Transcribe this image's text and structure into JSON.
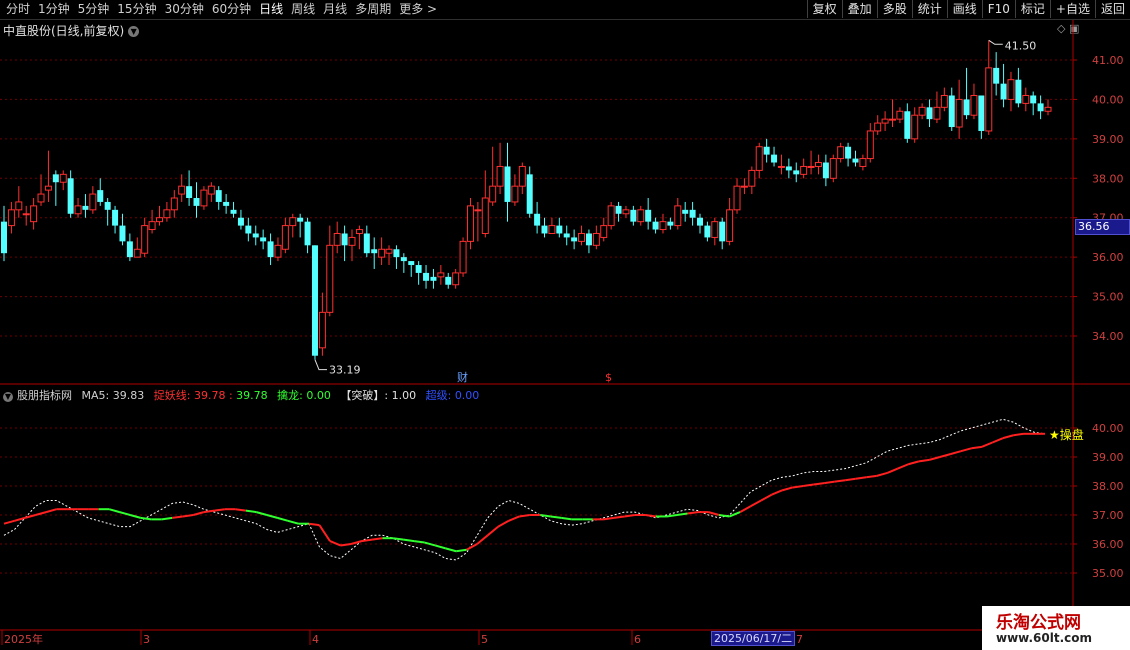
{
  "toolbar": {
    "periods": [
      "分时",
      "1分钟",
      "5分钟",
      "15分钟",
      "30分钟",
      "60分钟",
      "日线",
      "周线",
      "月线",
      "多周期",
      "更多 >"
    ],
    "actions": [
      "复权",
      "叠加",
      "多股",
      "统计",
      "画线",
      "F10",
      "标记",
      "+自选",
      "返回"
    ]
  },
  "stock": {
    "title": "中直股份(日线,前复权)"
  },
  "price_axis": {
    "labels": [
      "41.00",
      "40.00",
      "39.00",
      "38.00",
      "37.00",
      "36.00",
      "35.00",
      "34.00"
    ],
    "current": "36.56"
  },
  "indicator_axis": {
    "labels": [
      "40.00",
      "39.00",
      "38.00",
      "37.00",
      "36.00",
      "35.00"
    ]
  },
  "annotations": {
    "high": "41.50",
    "low": "33.19",
    "cai": "财",
    "s_marker": "$"
  },
  "indicator": {
    "name": "股朋指标网",
    "ma5_label": "MA5:",
    "ma5_value": "39.83",
    "line1_label": "捉妖线:",
    "line1_v1": "39.78",
    "sep": " : ",
    "line1_v2": "39.78",
    "line2_label": "擒龙:",
    "line2_value": "0.00",
    "line3_label": "【突破】:",
    "line3_value": "1.00",
    "line4_label": "超级:",
    "line4_value": "0.00",
    "signal": "★操盘"
  },
  "date_axis": {
    "labels": [
      "2025年",
      "3",
      "4",
      "5",
      "6",
      "7"
    ],
    "selected": "2025/06/17/二"
  },
  "watermark": {
    "line1": "乐淘公式网",
    "line2": "www.60lt.com"
  },
  "colors": {
    "up": "#ff3030",
    "down": "#54ffff",
    "grid": "#6e0000",
    "ma_red": "#ff2020",
    "ma_green": "#30ff30",
    "dotted": "#ffffff"
  },
  "chart_data": {
    "type": "candlestick",
    "candles": [
      [
        36.9,
        36.1,
        37.3,
        35.9
      ],
      [
        36.8,
        37.2,
        37.4,
        36.6
      ],
      [
        37.2,
        37.4,
        37.8,
        37.0
      ],
      [
        37.1,
        37.1,
        37.3,
        36.8
      ],
      [
        36.9,
        37.3,
        37.5,
        36.7
      ],
      [
        37.4,
        37.6,
        38.1,
        37.3
      ],
      [
        37.7,
        37.8,
        38.7,
        37.4
      ],
      [
        38.1,
        37.9,
        38.2,
        37.3
      ],
      [
        37.9,
        38.1,
        38.2,
        37.7
      ],
      [
        38.0,
        37.1,
        38.2,
        37.0
      ],
      [
        37.1,
        37.3,
        37.5,
        37.0
      ],
      [
        37.3,
        37.2,
        37.6,
        37.0
      ],
      [
        37.2,
        37.6,
        37.8,
        37.1
      ],
      [
        37.7,
        37.4,
        38.0,
        37.3
      ],
      [
        37.4,
        37.2,
        37.5,
        36.8
      ],
      [
        37.2,
        36.8,
        37.3,
        36.6
      ],
      [
        36.8,
        36.4,
        37.1,
        36.3
      ],
      [
        36.4,
        36.0,
        36.6,
        35.9
      ],
      [
        36.0,
        36.2,
        36.5,
        36.0
      ],
      [
        36.1,
        36.8,
        37.0,
        36.0
      ],
      [
        36.7,
        36.9,
        37.2,
        36.6
      ],
      [
        36.9,
        37.0,
        37.3,
        36.8
      ],
      [
        37.0,
        37.2,
        37.4,
        36.9
      ],
      [
        37.2,
        37.5,
        37.7,
        37.0
      ],
      [
        37.6,
        37.8,
        38.1,
        37.4
      ],
      [
        37.8,
        37.5,
        38.2,
        37.3
      ],
      [
        37.5,
        37.3,
        37.9,
        37.0
      ],
      [
        37.3,
        37.7,
        37.8,
        37.2
      ],
      [
        37.6,
        37.8,
        37.9,
        37.4
      ],
      [
        37.7,
        37.4,
        37.8,
        37.2
      ],
      [
        37.4,
        37.3,
        37.6,
        37.1
      ],
      [
        37.2,
        37.1,
        37.4,
        37.0
      ],
      [
        37.0,
        36.8,
        37.2,
        36.7
      ],
      [
        36.8,
        36.6,
        37.0,
        36.4
      ],
      [
        36.6,
        36.5,
        36.8,
        36.3
      ],
      [
        36.5,
        36.4,
        36.7,
        36.2
      ],
      [
        36.4,
        36.0,
        36.6,
        35.8
      ],
      [
        36.0,
        36.3,
        36.5,
        35.9
      ],
      [
        36.2,
        36.8,
        37.0,
        36.1
      ],
      [
        36.8,
        37.0,
        37.1,
        36.5
      ],
      [
        37.0,
        36.9,
        37.1,
        36.5
      ],
      [
        36.9,
        36.3,
        37.0,
        36.1
      ],
      [
        36.3,
        33.5,
        36.3,
        33.4
      ],
      [
        33.7,
        34.6,
        35.1,
        33.5
      ],
      [
        34.6,
        36.3,
        36.8,
        34.5
      ],
      [
        36.3,
        36.6,
        36.9,
        36.1
      ],
      [
        36.6,
        36.3,
        36.8,
        35.9
      ],
      [
        36.3,
        36.5,
        36.7,
        35.9
      ],
      [
        36.6,
        36.7,
        36.8,
        36.2
      ],
      [
        36.6,
        36.1,
        36.8,
        36.0
      ],
      [
        36.2,
        36.1,
        36.5,
        35.7
      ],
      [
        36.0,
        36.2,
        36.5,
        35.8
      ],
      [
        36.1,
        36.2,
        36.3,
        35.8
      ],
      [
        36.2,
        36.0,
        36.3,
        35.7
      ],
      [
        36.0,
        35.9,
        36.1,
        35.6
      ],
      [
        35.9,
        35.8,
        35.9,
        35.5
      ],
      [
        35.8,
        35.6,
        35.9,
        35.3
      ],
      [
        35.6,
        35.4,
        35.8,
        35.2
      ],
      [
        35.5,
        35.4,
        35.7,
        35.2
      ],
      [
        35.5,
        35.6,
        35.8,
        35.3
      ],
      [
        35.5,
        35.3,
        35.6,
        35.2
      ],
      [
        35.3,
        35.6,
        35.7,
        35.2
      ],
      [
        35.6,
        36.4,
        36.5,
        35.5
      ],
      [
        36.4,
        37.3,
        37.5,
        36.2
      ],
      [
        37.2,
        37.2,
        37.4,
        36.4
      ],
      [
        36.6,
        37.5,
        38.2,
        36.5
      ],
      [
        37.4,
        37.8,
        38.8,
        37.3
      ],
      [
        37.8,
        38.3,
        38.9,
        37.6
      ],
      [
        38.3,
        37.4,
        38.9,
        36.9
      ],
      [
        37.4,
        37.8,
        38.1,
        37.3
      ],
      [
        37.8,
        38.3,
        38.4,
        37.6
      ],
      [
        38.1,
        37.1,
        38.3,
        37.0
      ],
      [
        37.1,
        36.8,
        37.4,
        36.6
      ],
      [
        36.8,
        36.6,
        37.0,
        36.5
      ],
      [
        36.6,
        36.8,
        37.0,
        36.6
      ],
      [
        36.8,
        36.6,
        37.0,
        36.5
      ],
      [
        36.6,
        36.5,
        36.8,
        36.3
      ],
      [
        36.5,
        36.4,
        36.7,
        36.2
      ],
      [
        36.4,
        36.6,
        36.8,
        36.3
      ],
      [
        36.6,
        36.3,
        36.7,
        36.1
      ],
      [
        36.3,
        36.6,
        36.8,
        36.2
      ],
      [
        36.5,
        36.8,
        37.0,
        36.4
      ],
      [
        36.8,
        37.3,
        37.4,
        36.7
      ],
      [
        37.3,
        37.1,
        37.4,
        36.9
      ],
      [
        37.1,
        37.2,
        37.3,
        37.0
      ],
      [
        37.2,
        36.9,
        37.3,
        36.8
      ],
      [
        36.9,
        37.2,
        37.3,
        36.8
      ],
      [
        37.2,
        36.9,
        37.5,
        36.7
      ],
      [
        36.9,
        36.7,
        37.0,
        36.6
      ],
      [
        36.7,
        36.9,
        37.1,
        36.6
      ],
      [
        36.9,
        36.8,
        37.0,
        36.7
      ],
      [
        36.8,
        37.3,
        37.5,
        36.7
      ],
      [
        37.2,
        37.1,
        37.4,
        36.9
      ],
      [
        37.2,
        37.0,
        37.4,
        36.8
      ],
      [
        37.0,
        36.8,
        37.1,
        36.6
      ],
      [
        36.8,
        36.5,
        36.9,
        36.4
      ],
      [
        36.5,
        36.9,
        37.0,
        36.3
      ],
      [
        36.9,
        36.4,
        37.0,
        36.2
      ],
      [
        36.4,
        37.2,
        37.5,
        36.3
      ],
      [
        37.2,
        37.8,
        38.0,
        37.1
      ],
      [
        37.8,
        37.8,
        38.0,
        37.6
      ],
      [
        37.8,
        38.2,
        38.3,
        37.6
      ],
      [
        38.2,
        38.8,
        38.9,
        38.0
      ],
      [
        38.8,
        38.6,
        39.0,
        38.4
      ],
      [
        38.6,
        38.4,
        38.8,
        38.3
      ],
      [
        38.3,
        38.3,
        38.6,
        38.1
      ],
      [
        38.3,
        38.2,
        38.5,
        38.0
      ],
      [
        38.2,
        38.1,
        38.4,
        37.9
      ],
      [
        38.1,
        38.3,
        38.5,
        38.0
      ],
      [
        38.3,
        38.3,
        38.7,
        38.1
      ],
      [
        38.3,
        38.4,
        38.6,
        38.1
      ],
      [
        38.4,
        38.0,
        38.6,
        37.8
      ],
      [
        38.0,
        38.5,
        38.6,
        37.9
      ],
      [
        38.5,
        38.8,
        38.9,
        38.4
      ],
      [
        38.8,
        38.5,
        38.9,
        38.3
      ],
      [
        38.5,
        38.4,
        38.7,
        38.3
      ],
      [
        38.3,
        38.5,
        38.6,
        38.2
      ],
      [
        38.5,
        39.2,
        39.4,
        38.4
      ],
      [
        39.2,
        39.4,
        39.6,
        39.1
      ],
      [
        39.4,
        39.5,
        39.7,
        39.2
      ],
      [
        39.5,
        39.5,
        40.0,
        39.3
      ],
      [
        39.5,
        39.7,
        39.8,
        39.4
      ],
      [
        39.7,
        39.0,
        39.9,
        38.9
      ],
      [
        39.0,
        39.6,
        39.8,
        38.9
      ],
      [
        39.6,
        39.8,
        39.9,
        39.5
      ],
      [
        39.8,
        39.5,
        40.0,
        39.3
      ],
      [
        39.5,
        39.8,
        40.2,
        39.4
      ],
      [
        39.8,
        40.1,
        40.3,
        39.7
      ],
      [
        40.1,
        39.3,
        40.3,
        39.2
      ],
      [
        39.3,
        40.0,
        40.5,
        39.0
      ],
      [
        40.0,
        39.6,
        40.8,
        39.5
      ],
      [
        39.6,
        40.1,
        40.4,
        39.5
      ],
      [
        40.1,
        39.2,
        40.1,
        39.0
      ],
      [
        39.2,
        40.8,
        41.5,
        39.1
      ],
      [
        40.8,
        40.4,
        41.2,
        40.1
      ],
      [
        40.4,
        40.0,
        40.9,
        39.8
      ],
      [
        40.0,
        40.5,
        40.7,
        39.7
      ],
      [
        40.5,
        39.9,
        40.8,
        39.8
      ],
      [
        39.9,
        40.1,
        40.3,
        39.7
      ],
      [
        40.1,
        39.9,
        40.2,
        39.6
      ],
      [
        39.9,
        39.7,
        40.1,
        39.5
      ],
      [
        39.7,
        39.8,
        40.0,
        39.6
      ]
    ],
    "indicator_lines": {
      "ma": [
        36.7,
        36.8,
        36.9,
        37.0,
        37.1,
        37.2,
        37.2,
        37.2,
        37.2,
        37.2,
        37.2,
        37.1,
        37.0,
        36.9,
        36.85,
        36.85,
        36.9,
        36.95,
        37.0,
        37.1,
        37.15,
        37.2,
        37.2,
        37.15,
        37.1,
        37.0,
        36.9,
        36.8,
        36.7,
        36.7,
        36.65,
        36.1,
        35.95,
        36.0,
        36.1,
        36.15,
        36.2,
        36.2,
        36.15,
        36.1,
        36.05,
        35.95,
        35.85,
        35.75,
        35.8,
        36.0,
        36.3,
        36.6,
        36.8,
        36.95,
        37.0,
        37.0,
        36.95,
        36.9,
        36.85,
        36.85,
        36.85,
        36.85,
        36.9,
        36.95,
        37.0,
        37.0,
        36.95,
        36.95,
        37.0,
        37.05,
        37.1,
        37.1,
        37.0,
        36.95,
        37.1,
        37.3,
        37.5,
        37.7,
        37.85,
        37.95,
        38.0,
        38.05,
        38.1,
        38.15,
        38.2,
        38.25,
        38.3,
        38.35,
        38.45,
        38.6,
        38.75,
        38.85,
        38.9,
        39.0,
        39.1,
        39.2,
        39.3,
        39.35,
        39.5,
        39.65,
        39.75,
        39.8,
        39.8,
        39.8
      ],
      "color": [
        "r",
        "r",
        "r",
        "r",
        "r",
        "r",
        "r",
        "r",
        "r",
        "g",
        "g",
        "g",
        "g",
        "g",
        "g",
        "g",
        "r",
        "r",
        "r",
        "r",
        "r",
        "r",
        "r",
        "g",
        "g",
        "g",
        "g",
        "g",
        "g",
        "r",
        "r",
        "r",
        "r",
        "r",
        "r",
        "r",
        "g",
        "g",
        "g",
        "g",
        "g",
        "g",
        "g",
        "g",
        "r",
        "r",
        "r",
        "r",
        "r",
        "r",
        "r",
        "g",
        "g",
        "g",
        "g",
        "g",
        "r",
        "r",
        "r",
        "r",
        "r",
        "r",
        "g",
        "g",
        "g",
        "r",
        "r",
        "r",
        "g",
        "g",
        "r",
        "r",
        "r",
        "r",
        "r",
        "r",
        "r",
        "r",
        "r",
        "r",
        "r",
        "r",
        "r",
        "r",
        "r",
        "r",
        "r",
        "r",
        "r",
        "r",
        "r",
        "r",
        "r",
        "r",
        "r",
        "r",
        "r",
        "r",
        "r",
        "g"
      ],
      "dotted": [
        36.3,
        36.5,
        36.9,
        37.3,
        37.5,
        37.5,
        37.3,
        37.1,
        36.9,
        36.8,
        36.7,
        36.6,
        36.6,
        36.8,
        37.0,
        37.2,
        37.4,
        37.45,
        37.35,
        37.2,
        37.1,
        37.0,
        36.9,
        36.8,
        36.7,
        36.5,
        36.4,
        36.5,
        36.6,
        36.7,
        35.9,
        35.6,
        35.5,
        35.8,
        36.1,
        36.3,
        36.3,
        36.2,
        36.0,
        35.9,
        35.8,
        35.7,
        35.5,
        35.45,
        35.7,
        36.3,
        36.9,
        37.3,
        37.5,
        37.4,
        37.2,
        37.0,
        36.8,
        36.7,
        36.65,
        36.7,
        36.8,
        36.9,
        37.0,
        37.1,
        37.1,
        37.0,
        36.9,
        37.0,
        37.1,
        37.2,
        37.15,
        37.0,
        36.9,
        37.0,
        37.4,
        37.8,
        38.0,
        38.2,
        38.3,
        38.35,
        38.45,
        38.5,
        38.5,
        38.55,
        38.6,
        38.7,
        38.8,
        39.0,
        39.2,
        39.3,
        39.4,
        39.45,
        39.5,
        39.6,
        39.75,
        39.9,
        40.0,
        40.1,
        40.2,
        40.3,
        40.2,
        40.0,
        39.85,
        39.8
      ]
    }
  }
}
